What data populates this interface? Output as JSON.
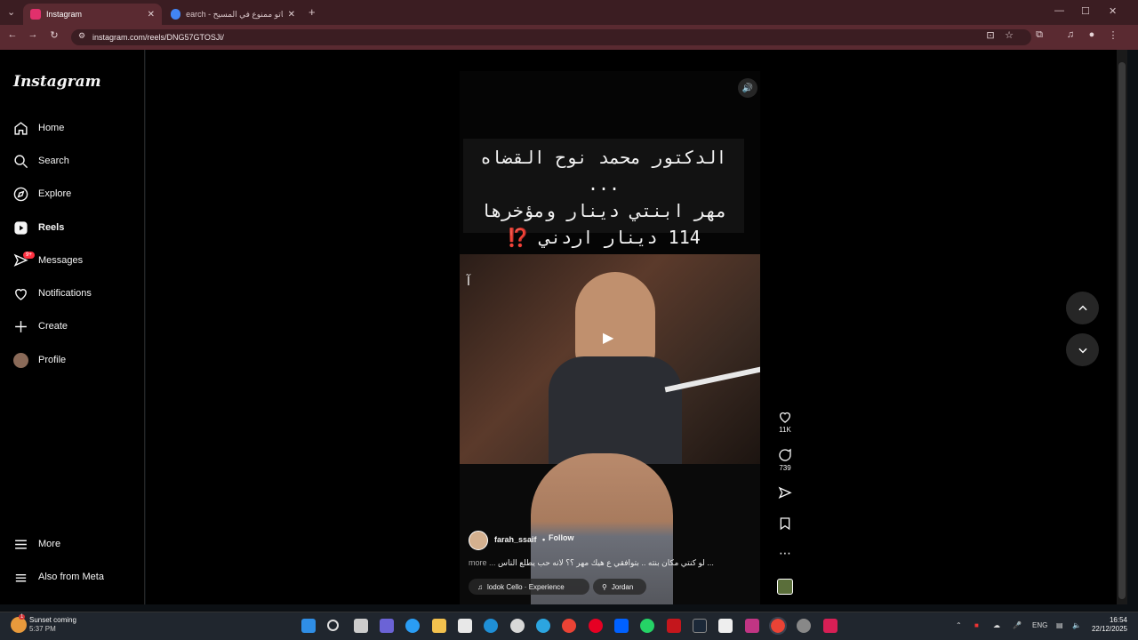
{
  "browser": {
    "tabs": [
      {
        "label": "Instagram",
        "active": true,
        "favicon_color": "#e1306c"
      },
      {
        "label": "earch - التاتو ممنوع في المسيح",
        "active": false,
        "favicon_color": "#4285f4"
      }
    ],
    "url": "instagram.com/reels/DNG57GTOSJi/"
  },
  "sidebar": {
    "logo": "Instagram",
    "items": [
      {
        "label": "Home",
        "icon": "home-icon"
      },
      {
        "label": "Search",
        "icon": "search-icon"
      },
      {
        "label": "Explore",
        "icon": "compass-icon"
      },
      {
        "label": "Reels",
        "icon": "reels-icon",
        "active": true
      },
      {
        "label": "Messages",
        "icon": "messenger-icon"
      },
      {
        "label": "Notifications",
        "icon": "heart-icon"
      },
      {
        "label": "Create",
        "icon": "plus-icon"
      },
      {
        "label": "Profile",
        "icon": "avatar"
      },
      {
        "label": "More",
        "icon": "menu-icon"
      },
      {
        "label": "Also from Meta",
        "icon": "meta-icon"
      }
    ],
    "messages_badge": "9+"
  },
  "reel": {
    "overlay_text_lines": [
      "الدكتور محمد نوح القضاه ...",
      "مهر ابنتي دينار ومؤخرها",
      "114 دينار اردني ⁉️"
    ],
    "watermark": "آ",
    "username": "farah_ssaif",
    "separator": "•",
    "follow_label": "Follow",
    "caption": "لو كنتي مكان بنته .. بتوافقي ع هيك مهر ؟؟ لانه حب يطلع الناس ...",
    "more_label": "more ...",
    "audio": "lodok Cello · Experience",
    "location": "Jordan"
  },
  "actions": {
    "likes": "11K",
    "comments": "739"
  },
  "taskbar": {
    "weather_line1": "Sunset coming",
    "weather_line2": "5:37 PM",
    "weather_badge": "1",
    "lang": "ENG",
    "time": "16:54",
    "date": "22/12/2025"
  }
}
